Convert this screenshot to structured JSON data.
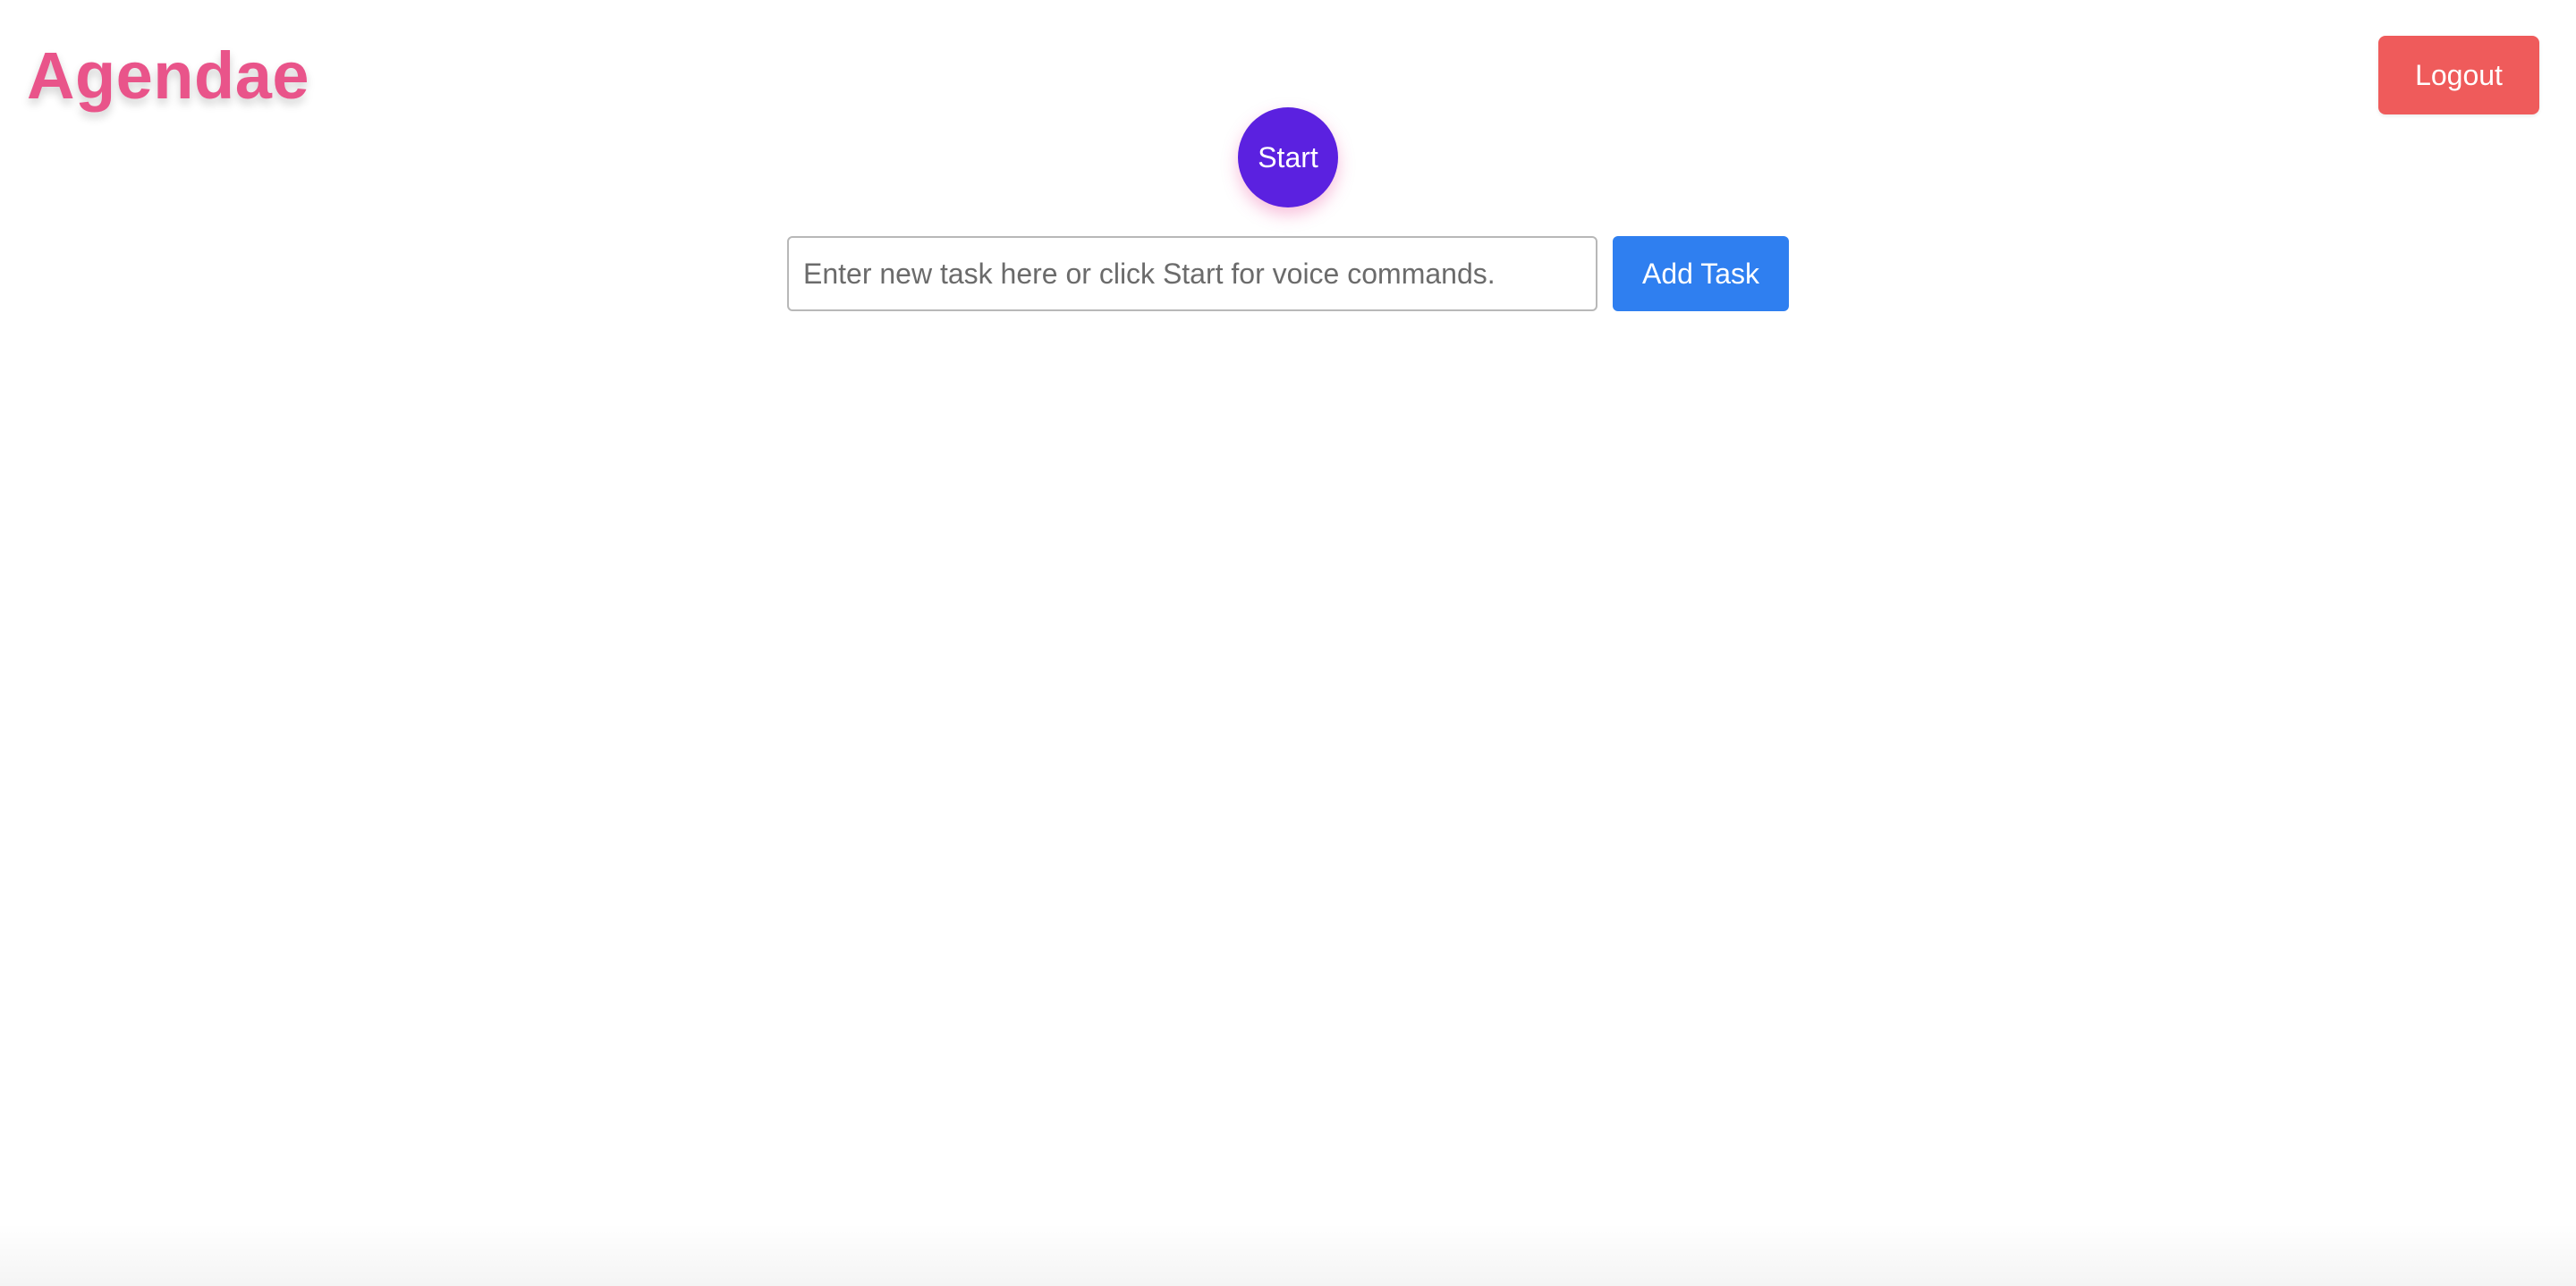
{
  "header": {
    "brand": "Agendae",
    "logout_label": "Logout"
  },
  "voice": {
    "start_label": "Start"
  },
  "task_form": {
    "input_value": "",
    "input_placeholder": "Enter new task here or click Start for voice commands.",
    "add_label": "Add Task"
  },
  "colors": {
    "brand": "#e9548a",
    "logout_bg": "#ef5b5b",
    "start_bg": "#5b21e0",
    "add_bg": "#2f7ff0"
  }
}
